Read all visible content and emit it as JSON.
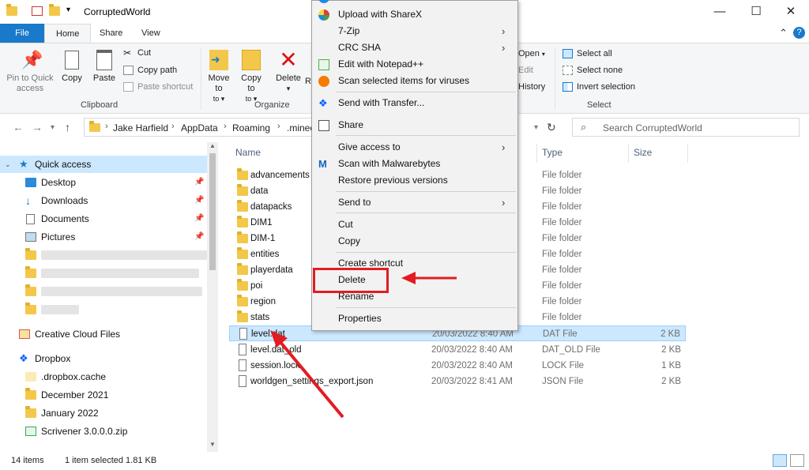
{
  "window": {
    "title": "CorruptedWorld",
    "minimize": "—",
    "maximize": "☐",
    "close": "✕"
  },
  "ribbon_tabs": {
    "file": "File",
    "home": "Home",
    "share": "Share",
    "view": "View",
    "help_glyph": "?"
  },
  "clipboard_group": {
    "pin_label": "Pin to Quick access",
    "copy_label": "Copy",
    "paste_label": "Paste",
    "cut_label": "Cut",
    "copy_path_label": "Copy path",
    "paste_shortcut_label": "Paste shortcut",
    "group_label": "Clipboard"
  },
  "organize_group": {
    "move_to_label": "Move to",
    "copy_to_label": "Copy to",
    "delete_label": "Delete",
    "rename_partial": "R",
    "group_label": "Organize"
  },
  "open_group": {
    "open_label": "Open",
    "edit_label": "Edit",
    "history_label": "History"
  },
  "select_group": {
    "select_all_label": "Select all",
    "select_none_label": "Select none",
    "invert_label": "Invert selection",
    "group_label": "Select"
  },
  "address": {
    "crumbs": [
      "Jake Harfield",
      "AppData",
      "Roaming",
      ".minec"
    ],
    "search_placeholder": "Search CorruptedWorld"
  },
  "nav": {
    "quick_access": "Quick access",
    "desktop": "Desktop",
    "downloads": "Downloads",
    "documents": "Documents",
    "pictures": "Pictures",
    "creative_cloud": "Creative Cloud Files",
    "dropbox": "Dropbox",
    "dropbox_cache": ".dropbox.cache",
    "december": "December 2021",
    "january": "January 2022",
    "scrivener": "Scrivener 3.0.0.0.zip"
  },
  "columns": {
    "name": "Name",
    "type": "Type",
    "size": "Size"
  },
  "files": [
    {
      "name": "advancements",
      "date": "",
      "type": "File folder",
      "size": ""
    },
    {
      "name": "data",
      "date": "",
      "type": "File folder",
      "size": ""
    },
    {
      "name": "datapacks",
      "date": "",
      "type": "File folder",
      "size": ""
    },
    {
      "name": "DIM1",
      "date": "",
      "type": "File folder",
      "size": ""
    },
    {
      "name": "DIM-1",
      "date": "",
      "type": "File folder",
      "size": ""
    },
    {
      "name": "entities",
      "date": "",
      "type": "File folder",
      "size": ""
    },
    {
      "name": "playerdata",
      "date": "",
      "type": "File folder",
      "size": ""
    },
    {
      "name": "poi",
      "date": "",
      "type": "File folder",
      "size": ""
    },
    {
      "name": "region",
      "date": "",
      "type": "File folder",
      "size": ""
    },
    {
      "name": "stats",
      "date": "",
      "type": "File folder",
      "size": ""
    },
    {
      "name": "level.dat",
      "date": "20/03/2022 8:40 AM",
      "type": "DAT File",
      "size": "2 KB"
    },
    {
      "name": "level.dat_old",
      "date": "20/03/2022 8:40 AM",
      "type": "DAT_OLD File",
      "size": "2 KB"
    },
    {
      "name": "session.lock",
      "date": "20/03/2022 8:40 AM",
      "type": "LOCK File",
      "size": "1 KB"
    },
    {
      "name": "worldgen_settings_export.json",
      "date": "20/03/2022 8:41 AM",
      "type": "JSON File",
      "size": "2 KB"
    }
  ],
  "status": {
    "items": "14 items",
    "selected": "1 item selected  1.81 KB"
  },
  "context_menu": {
    "upload_sharex": "Upload with ShareX",
    "zip": "7-Zip",
    "crc": "CRC SHA",
    "notepad": "Edit with Notepad++",
    "scan_viruses": "Scan selected items for viruses",
    "transfer": "Send with Transfer...",
    "share": "Share",
    "give_access": "Give access to",
    "malwarebytes": "Scan with Malwarebytes",
    "restore": "Restore previous versions",
    "send_to": "Send to",
    "cut": "Cut",
    "copy": "Copy",
    "create_shortcut": "Create shortcut",
    "delete": "Delete",
    "rename": "Rename",
    "properties": "Properties"
  },
  "colors": {
    "accent": "#1979ca",
    "selection": "#cce8ff",
    "annotation_red": "#e31b23",
    "folder_yellow": "#f3c84a"
  }
}
